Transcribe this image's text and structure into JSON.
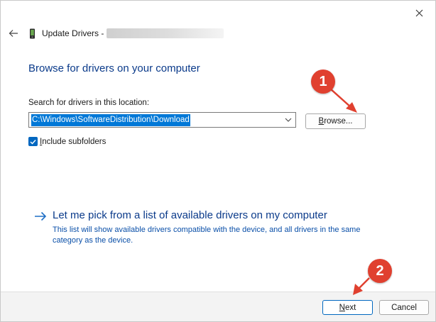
{
  "window": {
    "title": "Update Drivers -"
  },
  "icons": {
    "close": "close-icon",
    "back": "back-arrow-icon",
    "device": "device-icon",
    "dropdown": "chevron-down-icon",
    "check": "checkmark-icon",
    "link_arrow": "arrow-right-icon"
  },
  "main": {
    "heading": "Browse for drivers on your computer",
    "search_label": "Search for drivers in this location:",
    "path_value": "C:\\Windows\\SoftwareDistribution\\Download",
    "browse_mnemonic": "B",
    "browse_rest": "rowse...",
    "include_mnemonic": "I",
    "include_rest": "nclude subfolders",
    "include_checked": true
  },
  "pick": {
    "title": "Let me pick from a list of available drivers on my computer",
    "description": "This list will show available drivers compatible with the device, and all drivers in the same category as the device."
  },
  "footer": {
    "next_mnemonic": "N",
    "next_rest": "ext",
    "cancel": "Cancel"
  },
  "annotations": {
    "badge_1": "1",
    "badge_2": "2",
    "color": "#e0402f"
  },
  "colors": {
    "accent": "#0067c0",
    "link": "#0a3a8a",
    "selection": "#0078d7"
  }
}
